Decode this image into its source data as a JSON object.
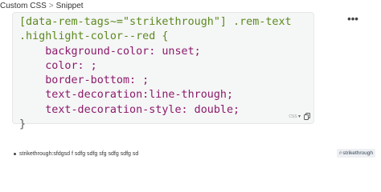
{
  "breadcrumb": {
    "parent": "Custom CSS",
    "separator": ">",
    "current": "Snippet"
  },
  "more_menu": {
    "icon": "more-horizontal-icon",
    "label": "•••"
  },
  "code_block": {
    "language": "CSS",
    "lines": [
      "[data-rem-tags~=\"strikethrough\"] .rem-text",
      ".highlight-color--red {",
      "    background-color: unset;",
      "    color: ;",
      "    border-bottom: ;",
      "    text-decoration:line-through;",
      "    text-decoration-style: double;",
      "}"
    ],
    "copy_icon": "copy-icon",
    "colors": {
      "selector": "#5c8a1e",
      "property": "#8b1a6b",
      "background": "#f5f6f6"
    }
  },
  "bullet": {
    "label": "strikethrough",
    "separator": ":",
    "text": " sfdgsd f sdfg sdfg sfg sdfg sdfg sd",
    "tag": {
      "hash": "#",
      "name": "strikethrough"
    }
  }
}
